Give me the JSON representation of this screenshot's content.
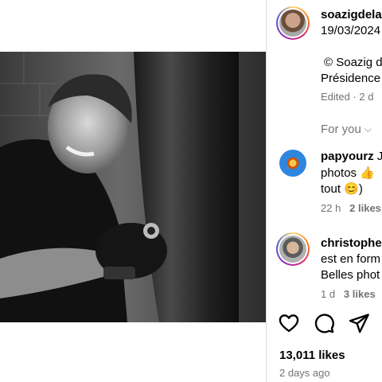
{
  "post": {
    "author": "soazigdela",
    "date": "19/03/2024",
    "caption_line1": "© Soazig d",
    "caption_line2": "Présidence",
    "edited_label": "Edited · 2 d"
  },
  "comments_filter": {
    "label": "For you",
    "chevron": "⌵"
  },
  "comments": [
    {
      "username": "papyourz",
      "line1_rest": " J",
      "line2": "photos 👍",
      "line3": "tout 😊)",
      "time": "22 h",
      "likes": "2 likes"
    },
    {
      "username": "christophe",
      "line1_rest": "",
      "line2": "est en form",
      "line3": "Belles phot",
      "time": "1 d",
      "likes": "3 likes"
    }
  ],
  "footer": {
    "likes": "13,011 likes",
    "time_ago": "2 days ago"
  },
  "icons": {
    "like": "heart-icon",
    "comment": "comment-icon",
    "share": "share-icon"
  }
}
